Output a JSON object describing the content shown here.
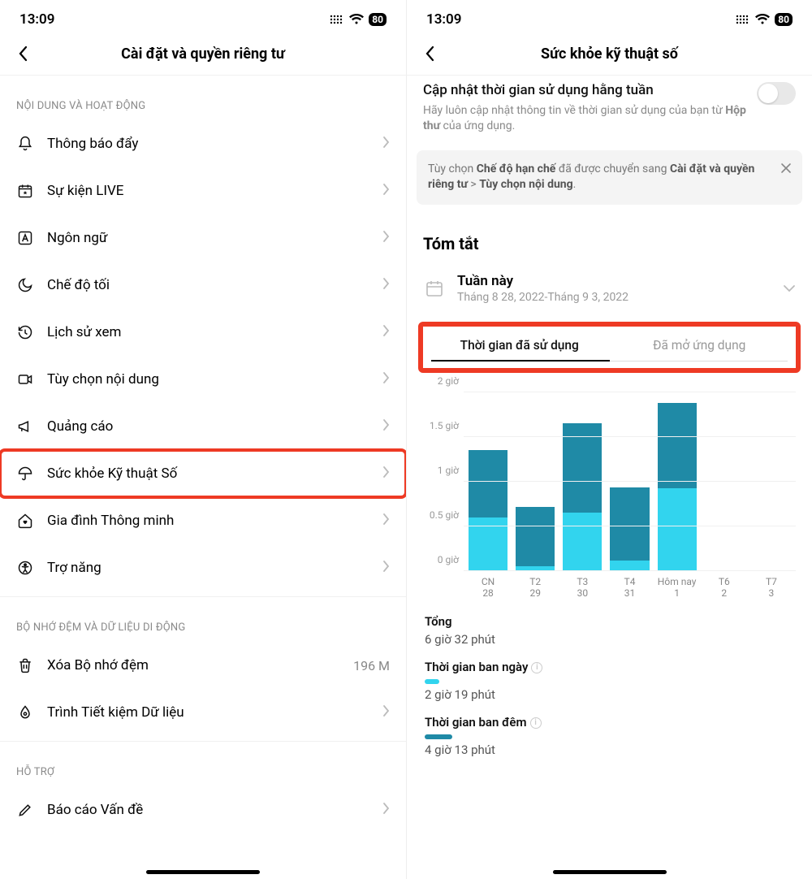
{
  "status": {
    "time": "13:09",
    "battery": "80"
  },
  "left": {
    "title": "Cài đặt và quyền riêng tư",
    "section1": "NỘI DUNG VÀ HOẠT ĐỘNG",
    "items": [
      {
        "label": "Thông báo đẩy",
        "icon": "bell"
      },
      {
        "label": "Sự kiện LIVE",
        "icon": "calendar-star"
      },
      {
        "label": "Ngôn ngữ",
        "icon": "letter-a"
      },
      {
        "label": "Chế độ tối",
        "icon": "moon"
      },
      {
        "label": "Lịch sử xem",
        "icon": "history"
      },
      {
        "label": "Tùy chọn nội dung",
        "icon": "video"
      },
      {
        "label": "Quảng cáo",
        "icon": "megaphone"
      },
      {
        "label": "Sức khỏe Kỹ thuật Số",
        "icon": "umbrella",
        "highlight": true
      },
      {
        "label": "Gia đình Thông minh",
        "icon": "home-heart"
      },
      {
        "label": "Trợ năng",
        "icon": "accessibility"
      }
    ],
    "section2": "BỘ NHỚ ĐỆM VÀ DỮ LIỆU DI ĐỘNG",
    "items2": [
      {
        "label": "Xóa Bộ nhớ đệm",
        "icon": "trash",
        "value": "196 M"
      },
      {
        "label": "Trình Tiết kiệm Dữ liệu",
        "icon": "drop"
      }
    ],
    "section3": "HỖ TRỢ",
    "items3": [
      {
        "label": "Báo cáo Vấn đề",
        "icon": "pen"
      }
    ]
  },
  "right": {
    "title": "Sức khỏe kỹ thuật số",
    "update_title": "Cập nhật thời gian sử dụng hằng tuần",
    "update_desc_pre": "Hãy luôn cập nhật thông tin về thời gian sử dụng của bạn từ ",
    "update_desc_bold": "Hộp thư",
    "update_desc_post": " của ứng dụng.",
    "notice_pre": "Tùy chọn ",
    "notice_b1": "Chế độ hạn chế",
    "notice_mid": " đã được chuyển sang ",
    "notice_b2": "Cài đặt và quyền riêng tư",
    "notice_post": " > ",
    "notice_b3": "Tùy chọn nội dung",
    "notice_end": ".",
    "summary_title": "Tóm tắt",
    "week_label": "Tuần này",
    "week_range": "Tháng 8 28, 2022-Tháng 9 3, 2022",
    "tab1": "Thời gian đã sử dụng",
    "tab2": "Đã mở ứng dụng",
    "total_label": "Tổng",
    "total_value": "6 giờ 32 phút",
    "day_label": "Thời gian ban ngày",
    "day_value": "2 giờ 19 phút",
    "night_label": "Thời gian ban đêm",
    "night_value": "4 giờ 13 phút"
  },
  "chart_data": {
    "type": "bar",
    "ylabel_unit": "giờ",
    "ylim": [
      0,
      2
    ],
    "yticks": [
      "0 giờ",
      "0.5 giờ",
      "1 giờ",
      "1.5 giờ",
      "2 giờ"
    ],
    "categories": [
      {
        "top": "CN",
        "bottom": "28"
      },
      {
        "top": "T2",
        "bottom": "29"
      },
      {
        "top": "T3",
        "bottom": "30"
      },
      {
        "top": "T4",
        "bottom": "31"
      },
      {
        "top": "Hôm nay",
        "bottom": "1"
      },
      {
        "top": "T6",
        "bottom": "2"
      },
      {
        "top": "T7",
        "bottom": "3"
      }
    ],
    "series": [
      {
        "name": "night",
        "color": "#1f8aa6",
        "values": [
          0.75,
          0.67,
          1.0,
          0.82,
          0.95,
          0,
          0
        ]
      },
      {
        "name": "day",
        "color": "#32d4ee",
        "values": [
          0.6,
          0.05,
          0.65,
          0.12,
          0.93,
          0,
          0
        ]
      }
    ],
    "totals": [
      1.35,
      0.72,
      1.65,
      0.94,
      1.88,
      0,
      0
    ]
  }
}
